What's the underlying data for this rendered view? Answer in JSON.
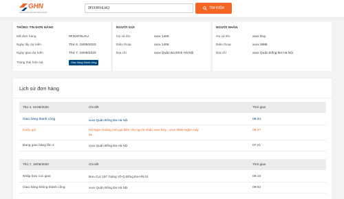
{
  "brand": {
    "name": "GHN",
    "tagline": "GIAO HÀNG NHANH TOÀN QUỐC"
  },
  "search": {
    "value": "9FIX4FHLHU",
    "button_label": "TÌM KIẾM"
  },
  "order_info": {
    "title": "THÔNG TIN ĐƠN HÀNG",
    "rows": [
      {
        "label": "Mã đơn hàng",
        "value": "9FIX4FHLHU"
      },
      {
        "label": "Ngày lấy dự kiến",
        "value": "Thứ 6, 18/09/2020"
      },
      {
        "label": "Ngày giao dự kiến",
        "value": "Thứ 7, 19/09/2020"
      }
    ],
    "status_label": "Trạng thái hiện tại:",
    "status_value": "Giao hàng thành công"
  },
  "sender": {
    "title": "NGƯỜI GỬI",
    "rows": [
      {
        "label": "Họ và tên",
        "value": "xxxx 1406"
      },
      {
        "label": "Điện thoại",
        "value": "xxxx 1406"
      },
      {
        "label": "Địa chỉ",
        "value": "xxxx Quận Ba Đình Hà Nội"
      }
    ]
  },
  "receiver": {
    "title": "NGƯỜI NHẬN",
    "rows": [
      {
        "label": "Họ và tên",
        "value": "xxxx Duy"
      },
      {
        "label": "Điện thoại",
        "value": "xxxx 3686"
      },
      {
        "label": "Địa chỉ",
        "value": "xxxx Quận Đống Đa Hà Nội"
      }
    ]
  },
  "history": {
    "title": "Lịch sử đơn hàng",
    "col_detail": "Chi tiết",
    "col_time": "Thời gian",
    "groups": [
      {
        "date": "Thứ 2, 21/09/2020",
        "events": [
          {
            "status": "Giao hàng thành công",
            "detail": "xxxx Quận Đống Đa Hà Nội",
            "time": "09:34",
            "tone": "blue"
          },
          {
            "status": "Cuộc gọi",
            "detail": "Hà Ngọc Hoàng Anh gọi điện cho người nhận xxxx Duy - xxxx 3686 Nghe máy 8s",
            "time": "09:27",
            "tone": "orange"
          },
          {
            "status": "Đang giao hàng lần 2",
            "detail": "xxxx Quận Đống Đa Hà Nội",
            "time": "07:21",
            "tone": "dark"
          }
        ]
      },
      {
        "date": "Thứ 7, 19/09/2020",
        "events": [
          {
            "status": "Nhập bưu cục giao",
            "detail": "Bưu Cục 187 Giảng Võ-Q.Đống Đa-HN 01",
            "time": "09:18",
            "tone": "dark"
          },
          {
            "status": "Giao hàng không thành công",
            "detail": "xxxx Quận Đống Đa Hà Nội",
            "time": "09:02",
            "tone": "dark"
          }
        ]
      }
    ]
  },
  "colors": {
    "brand_orange": "#f26522",
    "brand_blue": "#00467f"
  }
}
